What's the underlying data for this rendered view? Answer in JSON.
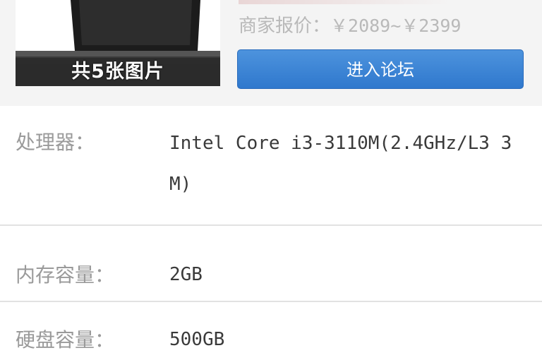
{
  "product": {
    "image_count_label": "共5张图片",
    "price_label": "商家报价：",
    "price_value": "￥2089~￥2399",
    "forum_button_label": "进入论坛"
  },
  "specs": [
    {
      "label": "处理器：",
      "value": "Intel Core i3-3110M(2.4GHz/L3 3M)"
    },
    {
      "label": "内存容量：",
      "value": "2GB"
    },
    {
      "label": "硬盘容量：",
      "value": "500GB"
    }
  ],
  "colors": {
    "button_blue": "#3a83d4",
    "header_bg": "#f4f4f4",
    "label_gray": "#9a9a9a",
    "value_dark": "#3a3a3a"
  }
}
